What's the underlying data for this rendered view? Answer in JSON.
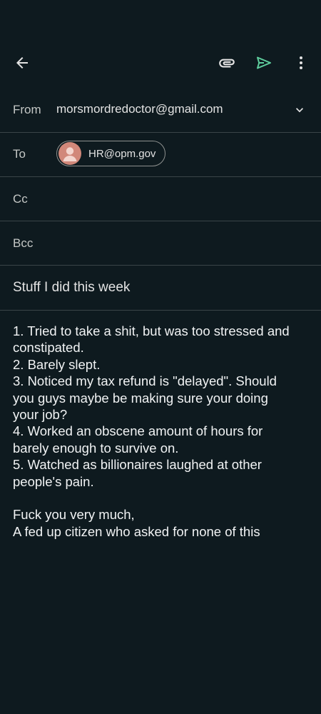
{
  "colors": {
    "background": "#0e1a1f",
    "send_accent": "#5fcf9e",
    "avatar": "#d1887a"
  },
  "toolbar": {
    "back_icon": "arrow-left-icon",
    "attach_icon": "paperclip-icon",
    "send_icon": "send-icon",
    "more_icon": "more-vert-icon"
  },
  "from": {
    "label": "From",
    "value": "morsmordredoctor@gmail.com"
  },
  "to": {
    "label": "To",
    "recipient": "HR@opm.gov"
  },
  "cc": {
    "label": "Cc"
  },
  "bcc": {
    "label": "Bcc"
  },
  "subject": {
    "value": "Stuff I did this week"
  },
  "body": {
    "lines": [
      "1. Tried to take a shit, but was too stressed and",
      "constipated.",
      "2. Barely slept.",
      "3. Noticed my tax refund is \"delayed\". Should",
      "you guys maybe be making sure your doing",
      "your job?",
      "4. Worked an obscene amount of hours for",
      "barely enough to survive on.",
      "5. Watched as billionaires laughed at other",
      "people's pain.",
      "",
      "Fuck you very much,",
      "A fed up citizen who asked for none of this"
    ]
  }
}
